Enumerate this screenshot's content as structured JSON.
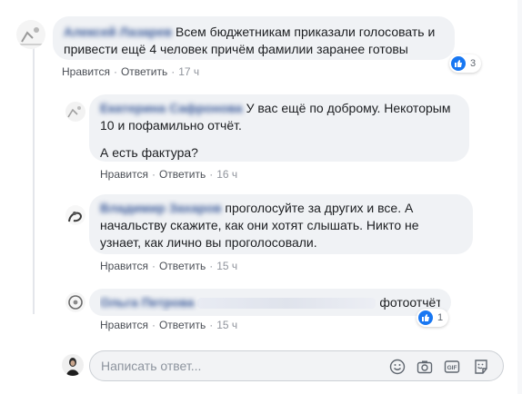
{
  "comments": [
    {
      "author": "Алексей Лазарев",
      "text_lines": [
        "Всем бюджетникам приказали голосовать и",
        "привести ещё 4 человек причём фамилии заранее готовы"
      ],
      "actions": {
        "like": "Нравится",
        "reply": "Ответить",
        "time": "17 ч"
      },
      "reactions": "3"
    },
    {
      "author": "Екатерина Сафронова",
      "text_lines": [
        "У вас ещё по доброму. Некоторым",
        "10 и пофамильно отчёт.",
        "",
        "А есть фактура?"
      ],
      "actions": {
        "like": "Нравится",
        "reply": "Ответить",
        "time": "16 ч"
      }
    },
    {
      "author": "Владимир Захаров",
      "text_lines": [
        "проголосуйте за других и все. А",
        "начальству скажите, как они хотят слышать. Никто не",
        "узнает, как лично вы проголосовали."
      ],
      "actions": {
        "like": "Нравится",
        "reply": "Ответить",
        "time": "15 ч"
      }
    },
    {
      "author": "Ольга Петрова",
      "text_lines": [
        "фотоотчёты"
      ],
      "actions": {
        "like": "Нравится",
        "reply": "Ответить",
        "time": "15 ч"
      },
      "reactions": "1"
    }
  ],
  "reply": {
    "placeholder": "Написать ответ..."
  },
  "icons": {
    "like": "like-icon",
    "emoji": "emoji-icon",
    "camera": "camera-icon",
    "gif": "gif-icon",
    "sticker": "sticker-icon"
  },
  "colors": {
    "link": "#385898",
    "like": "#1877f2",
    "bubble": "#f0f2f5"
  }
}
